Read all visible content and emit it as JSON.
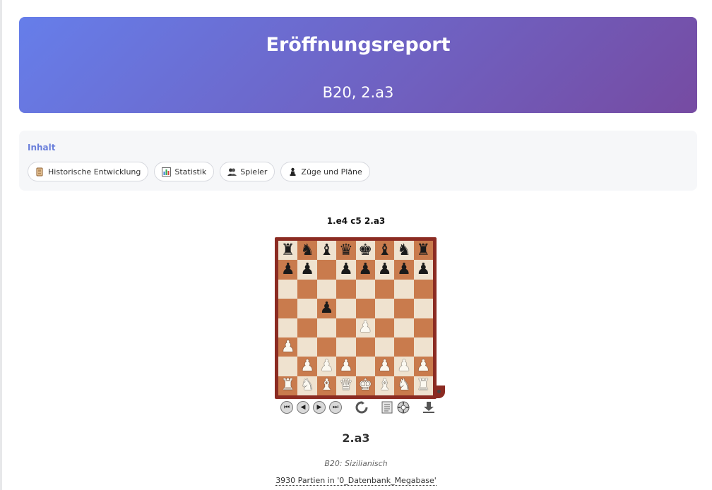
{
  "header": {
    "title": "Eröffnungsreport",
    "subtitle": "B20, 2.a3"
  },
  "toc": {
    "title": "Inhalt",
    "items": [
      {
        "label": "Historische Entwicklung",
        "icon": "scroll-icon"
      },
      {
        "label": "Statistik",
        "icon": "bar-chart-icon"
      },
      {
        "label": "Spieler",
        "icon": "players-icon"
      },
      {
        "label": "Züge und Pläne",
        "icon": "pawn-icon"
      }
    ]
  },
  "game": {
    "moves": "1.e4 c5 2.a3",
    "opening_name": "2.a3",
    "eco": "B20: Sizilianisch",
    "games_link": "3930 Partien in '0_Datenbank_Megabase'"
  },
  "board": {
    "rows": [
      "rnbqkbnr",
      "pp.ppppp",
      "........",
      "..p.....",
      "....P...",
      "P.......",
      ".PPP.PPP",
      "RNBQKBNR"
    ],
    "light_color": "#efe2cf",
    "dark_color": "#c97b4d",
    "frame_color": "#8b2b22"
  },
  "controls": [
    "first-move-icon",
    "previous-move-icon",
    "next-move-icon",
    "last-move-icon",
    "flip-board-icon",
    "notation-icon",
    "engine-icon",
    "download-icon"
  ]
}
